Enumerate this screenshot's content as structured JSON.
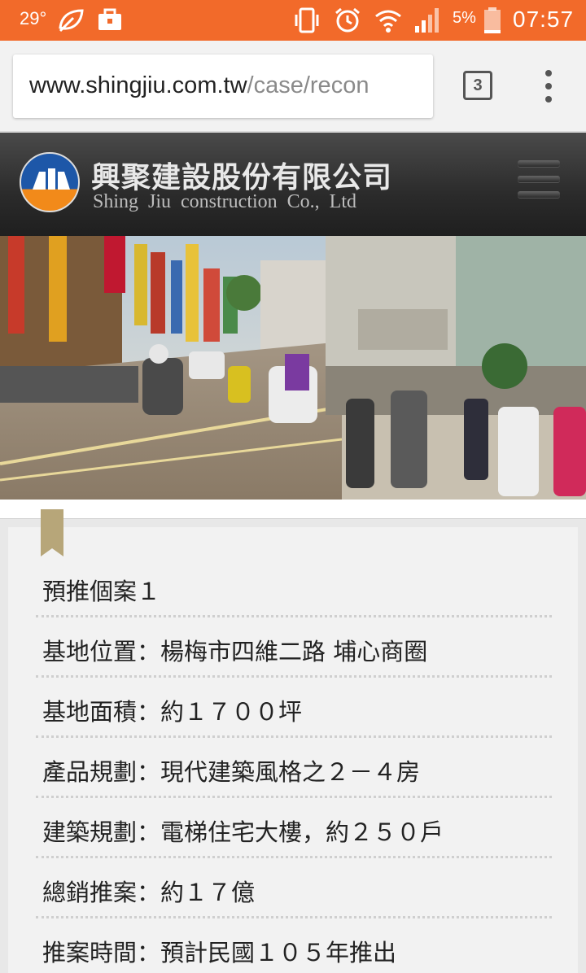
{
  "status_bar": {
    "temperature": "29°",
    "battery_percent": "5%",
    "time": "07:57",
    "colors": {
      "background": "#f26a2a"
    },
    "icons": [
      "leaf-icon",
      "briefcase-icon",
      "vibrate-icon",
      "alarm-icon",
      "wifi-icon",
      "signal-icon",
      "battery-icon"
    ]
  },
  "browser": {
    "url_host": "www.shingjiu.com.tw",
    "url_path": "/case/recon",
    "tab_count": "3",
    "menu_icon": "more-vert-icon"
  },
  "site_header": {
    "company_name_cn": "興聚建設股份有限公司",
    "company_name_en": "Shing Jiu  construction  Co., Ltd",
    "menu_icon": "hamburger-icon",
    "colors": {
      "logo_blue": "#1d57a8",
      "logo_orange": "#f28a1a"
    }
  },
  "case_info": {
    "title": "預推個案１",
    "rows": [
      "基地位置：楊梅市四維二路 埔心商圈",
      "基地面積：約１７００坪",
      "產品規劃：現代建築風格之２－４房",
      "建築規劃：電梯住宅大樓，約２５０戶",
      "總銷推案：約１７億",
      "推案時間：預計民國１０５年推出"
    ]
  }
}
